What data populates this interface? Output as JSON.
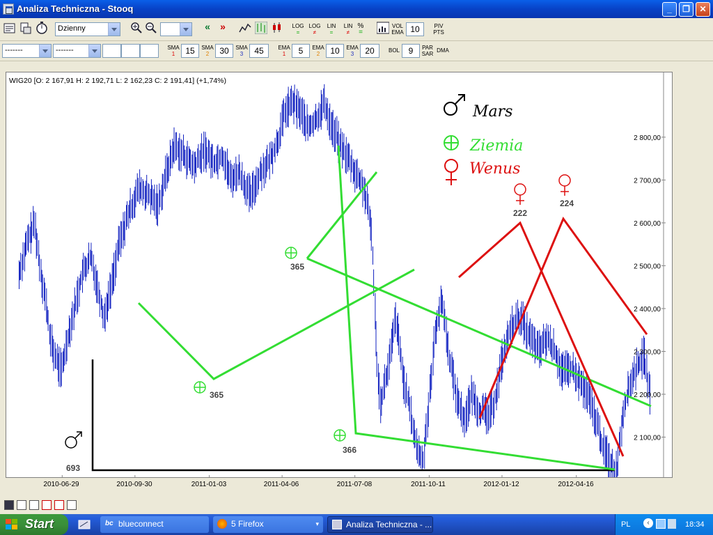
{
  "window": {
    "title": "Analiza Techniczna - Stooq"
  },
  "toolbar1": {
    "interval": "Dzienny",
    "zoom_value": "",
    "log_labels": [
      "LOG",
      "LOG",
      "LIN",
      "LIN"
    ],
    "percent": "%",
    "vol_label": "VOL",
    "ema_label": "EMA",
    "vol_value": "10",
    "piv_label": "PIV",
    "pts_label": "PTS"
  },
  "toolbar2": {
    "select1": "-------",
    "select2": "-------",
    "sma": [
      {
        "label": "SMA",
        "sub": "1",
        "value": "15"
      },
      {
        "label": "SMA",
        "sub": "2",
        "value": "30"
      },
      {
        "label": "SMA",
        "sub": "3",
        "value": "45"
      }
    ],
    "ema": [
      {
        "label": "EMA",
        "sub": "1",
        "value": "5"
      },
      {
        "label": "EMA",
        "sub": "2",
        "value": "10"
      },
      {
        "label": "EMA",
        "sub": "3",
        "value": "20"
      }
    ],
    "bol_label": "BOL",
    "bol_value": "9",
    "par_label": "PAR",
    "sar_label": "SAR",
    "dma_label": "DMA"
  },
  "chart": {
    "header": "WIG20 [O: 2 167,91  H: 2 192,71  L: 2 162,23  C: 2 191,41] (+1,74%)",
    "legend": [
      {
        "symbol": "♂",
        "name": "Mars",
        "color": "#000000"
      },
      {
        "symbol": "⊕",
        "name": "Ziemia",
        "color": "#33DD33"
      },
      {
        "symbol": "♀",
        "name": "Wenus",
        "color": "#DD1111"
      }
    ],
    "annotations": [
      "693",
      "365",
      "365",
      "366",
      "222",
      "224"
    ],
    "colors": {
      "price": "#1020C0",
      "earth": "#33DD33",
      "venus": "#DD1111",
      "mars": "#000000"
    }
  },
  "chart_data": {
    "type": "line",
    "title": "WIG20",
    "x_tick_labels": [
      "2010-06-29",
      "2010-09-30",
      "2011-01-03",
      "2011-04-06",
      "2011-07-08",
      "2011-10-11",
      "2012-01-12",
      "2012-04-16"
    ],
    "y_tick_labels": [
      "2 800,00",
      "2 700,00",
      "2 600,00",
      "2 500,00",
      "2 400,00",
      "2 300,00",
      "2 200,00",
      "2 100,00"
    ],
    "ylim": [
      2000,
      2925
    ],
    "grid": false,
    "series": [
      {
        "name": "WIG20",
        "points": [
          [
            "2010-05-05",
            2480
          ],
          [
            "2010-05-15",
            2550
          ],
          [
            "2010-05-25",
            2600
          ],
          [
            "2010-06-01",
            2500
          ],
          [
            "2010-06-08",
            2420
          ],
          [
            "2010-06-15",
            2320
          ],
          [
            "2010-06-22",
            2280
          ],
          [
            "2010-06-29",
            2255
          ],
          [
            "2010-07-06",
            2330
          ],
          [
            "2010-07-15",
            2400
          ],
          [
            "2010-07-25",
            2480
          ],
          [
            "2010-08-05",
            2520
          ],
          [
            "2010-08-15",
            2440
          ],
          [
            "2010-08-22",
            2380
          ],
          [
            "2010-09-01",
            2460
          ],
          [
            "2010-09-10",
            2550
          ],
          [
            "2010-09-22",
            2620
          ],
          [
            "2010-10-05",
            2680
          ],
          [
            "2010-10-20",
            2660
          ],
          [
            "2010-10-30",
            2640
          ],
          [
            "2010-11-10",
            2720
          ],
          [
            "2010-11-20",
            2780
          ],
          [
            "2010-12-01",
            2760
          ],
          [
            "2010-12-15",
            2730
          ],
          [
            "2010-12-28",
            2770
          ],
          [
            "2011-01-10",
            2740
          ],
          [
            "2011-01-20",
            2760
          ],
          [
            "2011-01-31",
            2700
          ],
          [
            "2011-02-10",
            2720
          ],
          [
            "2011-02-25",
            2660
          ],
          [
            "2011-03-10",
            2720
          ],
          [
            "2011-03-20",
            2740
          ],
          [
            "2011-04-01",
            2790
          ],
          [
            "2011-04-10",
            2860
          ],
          [
            "2011-04-20",
            2880
          ],
          [
            "2011-04-30",
            2860
          ],
          [
            "2011-05-10",
            2820
          ],
          [
            "2011-05-20",
            2840
          ],
          [
            "2011-05-30",
            2880
          ],
          [
            "2011-06-10",
            2820
          ],
          [
            "2011-06-20",
            2780
          ],
          [
            "2011-06-30",
            2750
          ],
          [
            "2011-07-08",
            2720
          ],
          [
            "2011-07-20",
            2680
          ],
          [
            "2011-07-30",
            2580
          ],
          [
            "2011-08-05",
            2300
          ],
          [
            "2011-08-10",
            2180
          ],
          [
            "2011-08-20",
            2260
          ],
          [
            "2011-08-30",
            2380
          ],
          [
            "2011-09-08",
            2240
          ],
          [
            "2011-09-15",
            2180
          ],
          [
            "2011-09-25",
            2080
          ],
          [
            "2011-10-03",
            2040
          ],
          [
            "2011-10-11",
            2180
          ],
          [
            "2011-10-20",
            2360
          ],
          [
            "2011-10-28",
            2420
          ],
          [
            "2011-11-05",
            2300
          ],
          [
            "2011-11-15",
            2200
          ],
          [
            "2011-11-25",
            2140
          ],
          [
            "2011-12-05",
            2200
          ],
          [
            "2011-12-15",
            2160
          ],
          [
            "2011-12-28",
            2150
          ],
          [
            "2012-01-05",
            2200
          ],
          [
            "2012-01-12",
            2280
          ],
          [
            "2012-01-25",
            2360
          ],
          [
            "2012-02-05",
            2380
          ],
          [
            "2012-02-15",
            2340
          ],
          [
            "2012-02-28",
            2300
          ],
          [
            "2012-03-10",
            2330
          ],
          [
            "2012-03-20",
            2300
          ],
          [
            "2012-03-30",
            2250
          ],
          [
            "2012-04-10",
            2260
          ],
          [
            "2012-04-20",
            2230
          ],
          [
            "2012-04-30",
            2200
          ],
          [
            "2012-05-10",
            2150
          ],
          [
            "2012-05-20",
            2080
          ],
          [
            "2012-05-30",
            2040
          ],
          [
            "2012-06-07",
            2020
          ],
          [
            "2012-06-15",
            2160
          ],
          [
            "2012-06-25",
            2230
          ],
          [
            "2012-07-05",
            2270
          ],
          [
            "2012-07-12",
            2290
          ],
          [
            "2012-07-20",
            2190
          ]
        ]
      }
    ]
  },
  "taskbar": {
    "start": "Start",
    "tasks": [
      "blueconnect",
      "5 Firefox",
      "Analiza Techniczna - ..."
    ],
    "lang": "PL",
    "clock": "18:34"
  }
}
